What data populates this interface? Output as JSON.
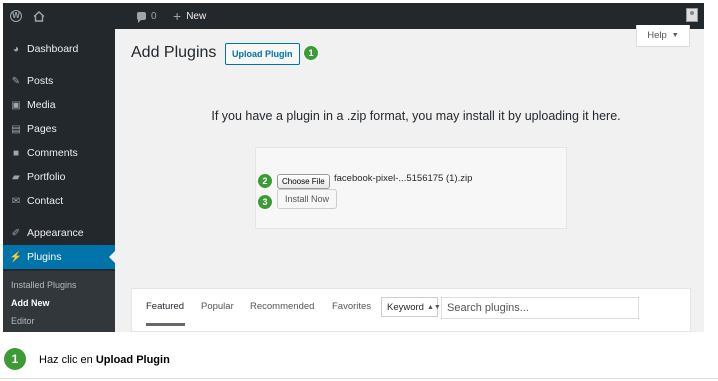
{
  "admin_bar": {
    "comments_count": "0",
    "new_label": "New"
  },
  "sidebar": {
    "items": [
      {
        "label": "Dashboard",
        "icon": "dashboard-icon"
      },
      {
        "label": "Posts",
        "icon": "pin-icon"
      },
      {
        "label": "Media",
        "icon": "media-icon"
      },
      {
        "label": "Pages",
        "icon": "pages-icon"
      },
      {
        "label": "Comments",
        "icon": "comment-icon"
      },
      {
        "label": "Portfolio",
        "icon": "folder-icon"
      },
      {
        "label": "Contact",
        "icon": "mail-icon"
      },
      {
        "label": "Appearance",
        "icon": "brush-icon"
      },
      {
        "label": "Plugins",
        "icon": "plug-icon"
      }
    ],
    "submenu": [
      "Installed Plugins",
      "Add New",
      "Editor"
    ]
  },
  "help": {
    "label": "Help"
  },
  "page": {
    "title": "Add Plugins",
    "upload_button": "Upload Plugin"
  },
  "steps": [
    "1",
    "2",
    "3"
  ],
  "upload": {
    "instructions": "If you have a plugin in a .zip format, you may install it by uploading it here.",
    "choose_file": "Choose File",
    "filename": "facebook-pixel-...5156175 (1).zip",
    "install_button": "Install Now"
  },
  "filter": {
    "tabs": [
      "Featured",
      "Popular",
      "Recommended",
      "Favorites"
    ],
    "search_type": "Keyword",
    "search_placeholder": "Search plugins..."
  },
  "caption": {
    "step": "1",
    "prefix": "Haz clic en",
    "bold": "Upload Plugin"
  },
  "colors": {
    "admin_bg": "#23282d",
    "active_menu": "#0073aa",
    "step_green": "#3d9b35"
  }
}
